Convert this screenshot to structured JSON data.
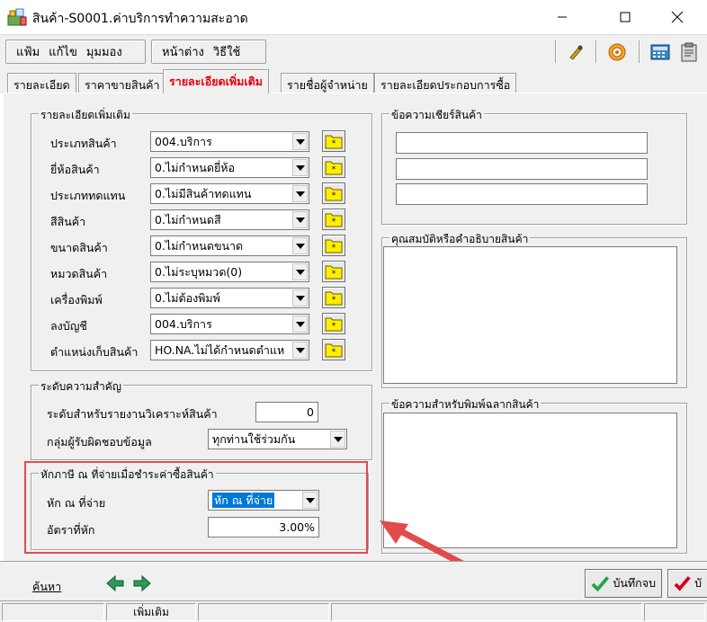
{
  "window": {
    "title": "สินค้า-S0001.ค่าบริการทำความสะอาด"
  },
  "menu": [
    "แฟ้ม",
    "แก้ไข",
    "มุมมอง"
  ],
  "menu2": [
    "หน้าต่าง",
    "วิธีใช้"
  ],
  "tabs": [
    {
      "label": "รายละเอียด"
    },
    {
      "label": "ราคาขายสินค้า"
    },
    {
      "label": "รายละเอียดเพิ่มเติม",
      "active": true
    },
    {
      "label": "รายชื่อผู้จำหน่าย"
    },
    {
      "label": "รายละเอียดประกอบการซื้อ"
    }
  ],
  "details": {
    "title": "รายละเอียดเพิ่มเติม",
    "rows": [
      {
        "label": "ประเภทสินค้า",
        "value": "004.บริการ"
      },
      {
        "label": "ยี่ห้อสินค้า",
        "value": "0.ไม่กำหนดยี่ห้อ"
      },
      {
        "label": "ประเภททดแทน",
        "value": "0.ไม่มีสินค้าทดแทน"
      },
      {
        "label": "สีสินค้า",
        "value": "0.ไม่กำหนดสี"
      },
      {
        "label": "ขนาดสินค้า",
        "value": "0.ไม่กำหนดขนาด"
      },
      {
        "label": "หมวดสินค้า",
        "value": "0.ไม่ระบุหมวด(0)"
      },
      {
        "label": "เครื่องพิมพ์",
        "value": "0.ไม่ต้องพิมพ์"
      },
      {
        "label": "ลงบัญชี",
        "value": "004.บริการ"
      },
      {
        "label": "ตำแหน่งเก็บสินค้า",
        "value": "HO.NA.ไม่ได้กำหนดตำแห"
      }
    ]
  },
  "importance": {
    "title": "ระดับความสำคัญ",
    "report_label": "ระดับสำหรับรายงานวิเคราะห์สินค้า",
    "report_value": "0",
    "group_label": "กลุ่มผู้รับผิดชอบข้อมูล",
    "group_value": "ทุกท่านใช้ร่วมกัน"
  },
  "withholding": {
    "title": "หักภาษี ณ ที่จ่ายเมื่อชำระค่าซื้อสินค้า",
    "type_label": "หัก ณ ที่จ่าย",
    "type_value": "หัก ณ ที่จ่าย",
    "rate_label": "อัตราที่หัก",
    "rate_value": "3.00%"
  },
  "right": {
    "promo_title": "ข้อความเชียร์สินค้า",
    "props_title": "คุณสมบัติหรือคำอธิบายสินค้า",
    "label_title": "ข้อความสำหรับพิมพ์ฉลากสินค้า"
  },
  "bottom": {
    "search": "ค้นหา",
    "save_close": "บันทึกจบ",
    "save_partial": "บั"
  },
  "status": {
    "mode": "เพิ่มเติม"
  },
  "colors": {
    "active_tab": "#e3000f",
    "highlight": "#e34b4b",
    "arrow": "#e34b4b",
    "selection": "#0078d7"
  }
}
